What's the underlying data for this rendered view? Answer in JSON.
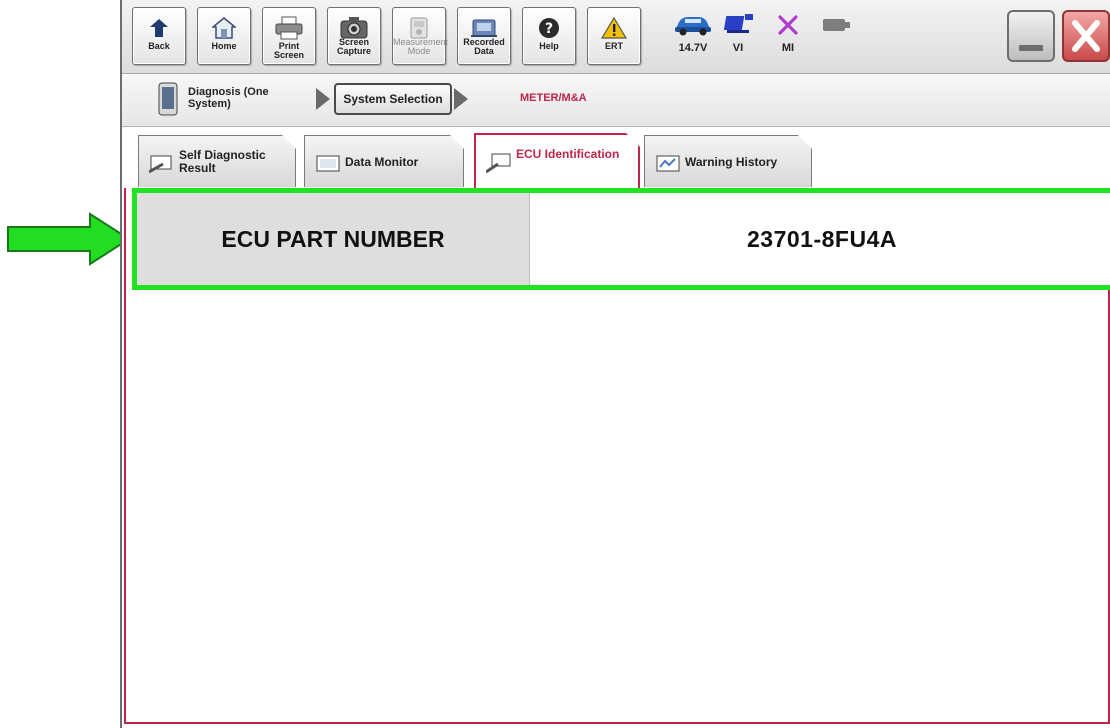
{
  "toolbar": {
    "buttons": [
      {
        "label": "Back",
        "icon": "back-arrow-icon"
      },
      {
        "label": "Home",
        "icon": "home-icon"
      },
      {
        "label": "Print Screen",
        "icon": "printer-icon"
      },
      {
        "label": "Screen Capture",
        "icon": "camera-icon"
      },
      {
        "label": "Measurement Mode",
        "icon": "measurement-icon",
        "state": "disabled"
      },
      {
        "label": "Recorded Data",
        "icon": "recorded-data-icon"
      },
      {
        "label": "Help",
        "icon": "help-icon"
      },
      {
        "label": "ERT",
        "icon": "warning-triangle-icon"
      }
    ],
    "status": {
      "voltage": "14.7V",
      "vi": "VI",
      "mi": "MI"
    }
  },
  "breadcrumb": {
    "diagnosis": "Diagnosis (One System)",
    "system_selection": "System Selection",
    "current": "METER/M&A"
  },
  "tabs": [
    {
      "label": "Self Diagnostic Result",
      "active": false
    },
    {
      "label": "Data Monitor",
      "active": false
    },
    {
      "label": "ECU Identification",
      "active": true
    },
    {
      "label": "Warning History",
      "active": false
    }
  ],
  "ecu": {
    "label": "ECU PART NUMBER",
    "value": "23701-8FU4A"
  },
  "colors": {
    "accent": "#c0254a",
    "highlight": "#22e022",
    "pointer": "#22dd22"
  }
}
